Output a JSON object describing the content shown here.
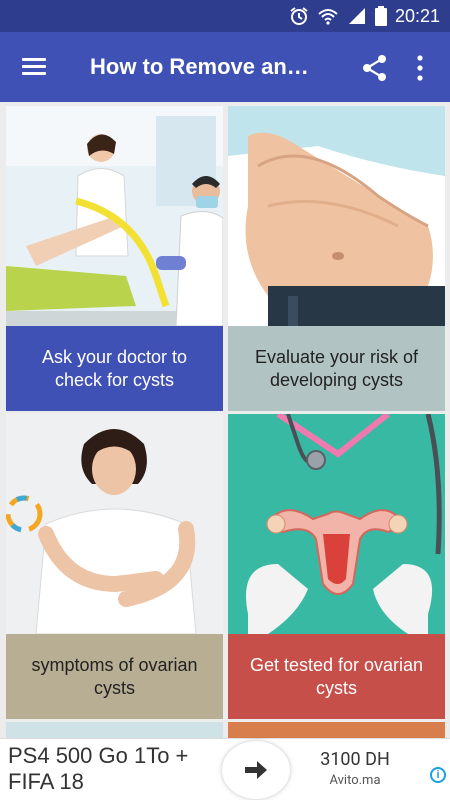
{
  "status_bar": {
    "time": "20:21",
    "icons": [
      "alarm-icon",
      "wifi-icon",
      "signal-icon",
      "battery-icon"
    ]
  },
  "app_bar": {
    "title": "How to Remove an…",
    "menu_icon": "hamburger-menu-icon",
    "share_icon": "share-icon",
    "more_icon": "more-vert-icon",
    "color": "#3f51b5"
  },
  "cards": [
    {
      "caption": "Ask your doctor to check for cysts",
      "caption_color": "#3f51b5",
      "text_color": "#ffffff",
      "image": "doctor-exam-photo"
    },
    {
      "caption": "Evaluate your risk of developing cysts",
      "caption_color": "#b1c3c3",
      "text_color": "#222222",
      "image": "abdomen-photo"
    },
    {
      "caption": "symptoms of ovarian cysts",
      "caption_color": "#b7ae94",
      "text_color": "#222222",
      "image": "woman-abdominal-pain-photo"
    },
    {
      "caption": "Get tested for ovarian cysts",
      "caption_color": "#c64f4a",
      "text_color": "#ffffff",
      "image": "uterus-model-photo"
    }
  ],
  "ad": {
    "title": "PS4 500 Go 1To + FIFA 18",
    "price": "3100 DH",
    "site": "Avito.ma",
    "go_icon": "arrow-right-icon",
    "info_icon": "ad-info-icon"
  }
}
